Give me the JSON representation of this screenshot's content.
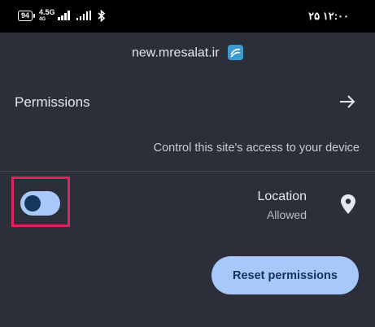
{
  "status_bar": {
    "battery": "94",
    "network_type": "4.5G",
    "network_sub": "4G",
    "time": "۲۵  ۱۲:۰۰"
  },
  "site": {
    "name": "new.mresalat.ir",
    "icon": "site-favicon-icon"
  },
  "permissions": {
    "title": "Permissions",
    "description": "Control this site's access to your device",
    "arrow_icon": "arrow-right-icon"
  },
  "location": {
    "label": "Location",
    "status": "Allowed",
    "toggle_on": true,
    "icon": "location-pin-icon"
  },
  "reset_button": {
    "label": "Reset permissions"
  },
  "colors": {
    "background": "#2b2f3a",
    "accent": "#a8c7fa",
    "highlight": "#e0245e"
  }
}
